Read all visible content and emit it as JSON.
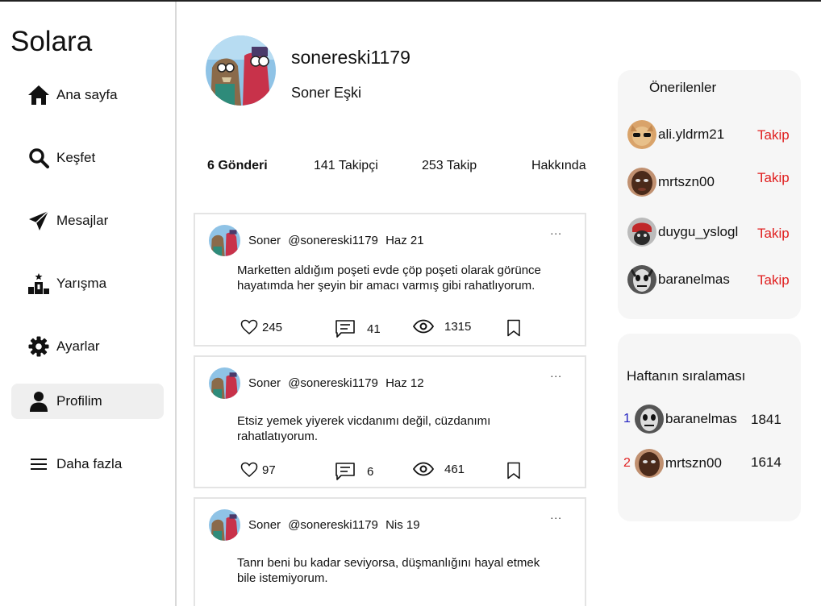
{
  "app": {
    "brand": "Solara"
  },
  "nav": [
    {
      "label": "Ana sayfa",
      "icon": "home-icon"
    },
    {
      "label": "Keşfet",
      "icon": "search-icon"
    },
    {
      "label": "Mesajlar",
      "icon": "send-icon"
    },
    {
      "label": "Yarışma",
      "icon": "podium-icon"
    },
    {
      "label": "Ayarlar",
      "icon": "gear-icon"
    },
    {
      "label": "Profilim",
      "icon": "user-icon",
      "active": true
    },
    {
      "label": "Daha fazla",
      "icon": "menu-icon"
    }
  ],
  "profile": {
    "username": "sonereski1179",
    "fullname": "Soner Eşki",
    "stats": {
      "posts": "6 Gönderi",
      "followers": "141 Takipçi",
      "following": "253 Takip",
      "about": "Hakkında"
    }
  },
  "posts": [
    {
      "name": "Soner",
      "handle": "@sonereski1179",
      "date": "Haz 21",
      "more": "...",
      "text": "Marketten aldığım poşeti evde çöp poşeti olarak görünce hayatımda her şeyin bir amacı varmış gibi rahatlıyorum.",
      "likes": "245",
      "comments": "41",
      "views": "1315"
    },
    {
      "name": "Soner",
      "handle": "@sonereski1179",
      "date": "Haz 12",
      "more": "...",
      "text": "Etsiz yemek yiyerek vicdanımı değil, cüzdanımı rahatlatıyorum.",
      "likes": "97",
      "comments": "6",
      "views": "461"
    },
    {
      "name": "Soner",
      "handle": "@sonereski1179",
      "date": "Nis 19",
      "more": "...",
      "text": "Tanrı beni bu kadar seviyorsa, düşmanlığını hayal etmek bile istemiyorum.",
      "likes": "",
      "comments": "",
      "views": ""
    }
  ],
  "suggestions": {
    "title": "Önerilenler",
    "follow_label": "Takip",
    "items": [
      {
        "name": "ali.yldrm21"
      },
      {
        "name": "mrtszn00"
      },
      {
        "name": "duygu_yslogl"
      },
      {
        "name": "baranelmas"
      }
    ]
  },
  "ranking": {
    "title": "Haftanın sıralaması",
    "items": [
      {
        "rank": "1",
        "name": "baranelmas",
        "score": "1841",
        "rank_color": "#2020c0"
      },
      {
        "rank": "2",
        "name": "mrtszn00",
        "score": "1614",
        "rank_color": "#e02020"
      }
    ]
  },
  "colors": {
    "follow": "#e02020",
    "active_nav_bg": "#efefef",
    "panel_bg": "#f6f6f6"
  }
}
